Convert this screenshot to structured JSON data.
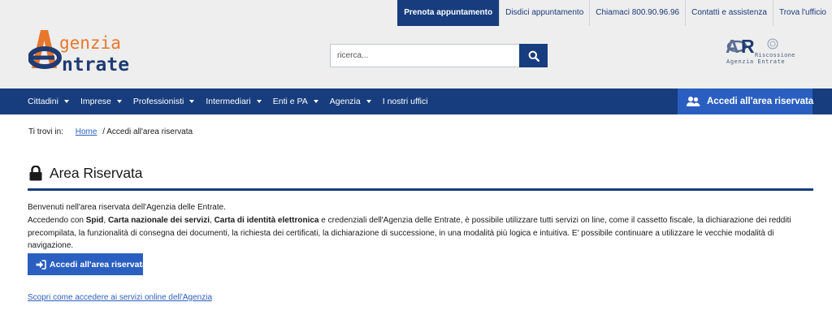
{
  "topbar": {
    "links": [
      {
        "label": "Prenota appuntamento",
        "name": "topbar-prenota-link"
      },
      {
        "label": "Disdici appuntamento",
        "name": "topbar-disdici-link"
      },
      {
        "label": "Chiamaci 800.90.96.96",
        "name": "topbar-chiamaci-link"
      },
      {
        "label": "Contatti e assistenza",
        "name": "topbar-contatti-link"
      },
      {
        "label": "Trova l'ufficio",
        "name": "topbar-trova-ufficio-link"
      }
    ]
  },
  "logo": {
    "line1": "genzia",
    "line2": "ntrate"
  },
  "search": {
    "placeholder": "ricerca..."
  },
  "riscossione": {
    "line1": "Riscossione",
    "line2": "Agenzia Entrate"
  },
  "nav": {
    "items": [
      {
        "label": "Cittadini",
        "caret": true
      },
      {
        "label": "Imprese",
        "caret": true
      },
      {
        "label": "Professionisti",
        "caret": true
      },
      {
        "label": "Intermediari",
        "caret": true
      },
      {
        "label": "Enti e PA",
        "caret": true
      },
      {
        "label": "Agenzia",
        "caret": true
      },
      {
        "label": "I nostri uffici",
        "caret": false
      }
    ],
    "login_label": "Accedi all'area riservata"
  },
  "breadcrumb": {
    "label": "Ti trovi in:",
    "home": "Home",
    "current": "/ Accedi all'area riservata"
  },
  "page": {
    "title": "Area Riservata",
    "intro_line1": "Benvenuti nell'area riservata dell'Agenzia delle Entrate.",
    "intro_p2_a": "Accedendo con ",
    "intro_p2_spid": "Spid",
    "intro_p2_sep1": ", ",
    "intro_p2_cns": "Carta nazionale dei servizi",
    "intro_p2_sep2": ", ",
    "intro_p2_cie": "Carta di identità elettronica",
    "intro_p2_b": " e credenziali dell'Agenzia delle Entrate, è possibile utilizzare tutti servizi on line, come il cassetto fiscale, la dichiarazione dei redditi precompilata, la funzionalità di consegna dei documenti, la richiesta dei certificati, la dichiarazione di successione, in una modalità più logica e intuitiva. E' possibile continuare a utilizzare le vecchie modalità di navigazione.",
    "login_button": "Accedi all'area riservata",
    "discover_link": "Scopri come accedere ai servizi online dell'Agenzia"
  },
  "colors": {
    "navy": "#173d7e",
    "blue": "#2a5fc1",
    "logo_orange": "#e8772e",
    "logo_navy": "#1f3b73"
  },
  "icons": {
    "search": "search-icon",
    "users": "users-icon",
    "lock": "lock-icon",
    "login": "sign-in-icon",
    "caret": "caret-down-icon"
  }
}
